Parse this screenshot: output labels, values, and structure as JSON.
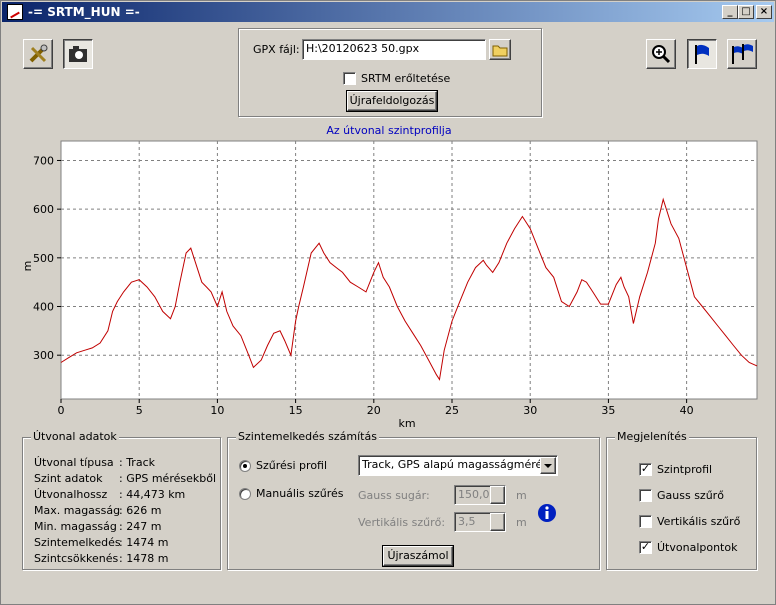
{
  "window": {
    "title": "-= SRTM_HUN =-",
    "controls": {
      "minimize": "_",
      "maximize": "□",
      "close": "×"
    }
  },
  "toolbar_left": [
    {
      "icon": "tools-icon"
    },
    {
      "icon": "camera-icon"
    }
  ],
  "toolbar_right": [
    {
      "icon": "zoom-icon"
    },
    {
      "icon": "flag-icon"
    },
    {
      "icon": "flags-icon"
    }
  ],
  "gpx": {
    "label": "GPX fájl:",
    "value": "H:\\20120623 50.gpx",
    "srtm_label": "SRTM erőltetése",
    "srtm_checked": false,
    "reprocess": "Újrafeldolgozás"
  },
  "chart_data": {
    "type": "line",
    "title": "Az útvonal szintprofilja",
    "xlabel": "km",
    "ylabel": "m",
    "xlim": [
      0,
      44.5
    ],
    "ylim": [
      210,
      740
    ],
    "xticks": [
      0,
      5,
      10,
      15,
      20,
      25,
      30,
      35,
      40
    ],
    "yticks": [
      300,
      400,
      500,
      600,
      700
    ],
    "grid": true,
    "line_color": "#c00000",
    "series": [
      {
        "x": [
          0,
          0.5,
          1,
          1.5,
          2,
          2.5,
          3,
          3.3,
          3.6,
          4,
          4.5,
          5,
          5.5,
          6,
          6.5,
          7,
          7.3,
          7.6,
          8,
          8.3,
          8.6,
          9,
          9.3,
          9.6,
          10,
          10.3,
          10.6,
          11,
          11.5,
          12,
          12.3,
          12.8,
          13.2,
          13.6,
          14,
          14.3,
          14.7,
          15,
          15.2,
          15.5,
          16,
          16.5,
          16.8,
          17.2,
          17.6,
          18,
          18.5,
          19,
          19.5,
          20,
          20.3,
          20.6,
          21,
          21.5,
          22,
          22.5,
          23,
          23.5,
          24,
          24.2,
          24.5,
          25,
          25.5,
          26,
          26.5,
          27,
          27.2,
          27.6,
          28,
          28.5,
          29,
          29.5,
          30,
          30.5,
          31,
          31.5,
          32,
          32.5,
          33,
          33.3,
          33.6,
          34,
          34.5,
          35,
          35.5,
          35.8,
          36,
          36.3,
          36.6,
          37,
          37.5,
          38,
          38.2,
          38.5,
          39,
          39.5,
          40,
          40.5,
          41,
          41.5,
          42,
          42.5,
          43,
          43.5,
          44,
          44.5
        ],
        "y": [
          285,
          295,
          305,
          310,
          315,
          325,
          350,
          390,
          410,
          430,
          450,
          455,
          440,
          420,
          390,
          375,
          400,
          450,
          510,
          520,
          490,
          450,
          440,
          430,
          400,
          430,
          390,
          360,
          340,
          300,
          275,
          290,
          320,
          345,
          350,
          330,
          300,
          370,
          400,
          440,
          510,
          530,
          510,
          490,
          480,
          470,
          450,
          440,
          430,
          470,
          490,
          460,
          440,
          400,
          370,
          345,
          320,
          290,
          260,
          250,
          310,
          370,
          410,
          450,
          480,
          495,
          485,
          470,
          490,
          530,
          560,
          585,
          560,
          520,
          480,
          460,
          410,
          400,
          430,
          455,
          450,
          430,
          405,
          405,
          445,
          460,
          440,
          420,
          365,
          420,
          470,
          530,
          580,
          620,
          570,
          540,
          480,
          420,
          400,
          380,
          360,
          340,
          320,
          300,
          285,
          278
        ]
      }
    ]
  },
  "route": {
    "legend": "Útvonal adatok",
    "rows": [
      {
        "k": "Útvonal típusa",
        "v": ": Track"
      },
      {
        "k": "Szint adatok",
        "v": ": GPS mérésekből"
      },
      {
        "k": "Útvonalhossz",
        "v": ": 44,473 km"
      },
      {
        "k": "Max. magasság",
        "v": ": 626 m"
      },
      {
        "k": "Min. magasság",
        "v": ": 247 m"
      },
      {
        "k": "Szintemelkedés",
        "v": ": 1474 m"
      },
      {
        "k": "Szintcsökkenés",
        "v": ": 1478 m"
      }
    ]
  },
  "calc": {
    "legend": "Szintemelkedés számítás",
    "filter_profile": "Szűrési profil",
    "manual": "Manuális szűrés",
    "profile_value": "Track, GPS alapú magasságmérés",
    "gauss_label": "Gauss sugár:",
    "gauss_value": "150,0",
    "vert_label": "Vertikális szűrő:",
    "vert_value": "3,5",
    "unit": "m",
    "recalc": "Újraszámol"
  },
  "display": {
    "legend": "Megjelenítés",
    "items": [
      {
        "label": "Szintprofil",
        "checked": true
      },
      {
        "label": "Gauss szűrő",
        "checked": false
      },
      {
        "label": "Vertikális szűrő",
        "checked": false
      },
      {
        "label": "Útvonalpontok",
        "checked": true
      }
    ]
  }
}
